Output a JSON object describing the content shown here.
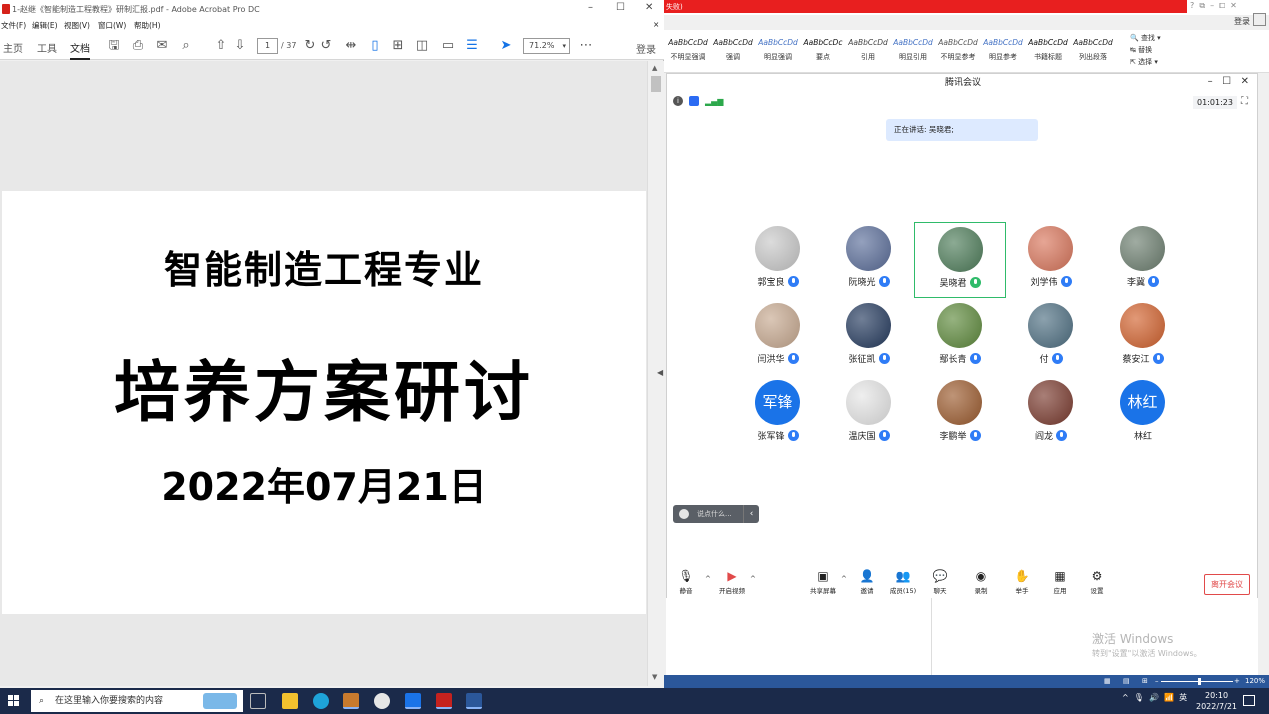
{
  "acrobat": {
    "title": "1-赵继《智能制造工程教程》研制汇报.pdf - Adobe Acrobat Pro DC",
    "menu": [
      "文件(F)",
      "编辑(E)",
      "视图(V)",
      "窗口(W)",
      "帮助(H)"
    ],
    "nav": [
      "主页",
      "工具",
      "文档"
    ],
    "page_current": "1",
    "page_total": "/ 37",
    "zoom": "71.2%",
    "login": "登录",
    "doc": {
      "line1": "智能制造工程专业",
      "line2": "培养方案研讨",
      "line3": "2022年07月21日"
    }
  },
  "word": {
    "banner": "失败)",
    "login": "登录",
    "styles": [
      {
        "sample": "AaBbCcDd",
        "name": "不明显强调",
        "color": "#222222"
      },
      {
        "sample": "AaBbCcDd",
        "name": "强调",
        "color": "#222222"
      },
      {
        "sample": "AaBbCcDd",
        "name": "明显强调",
        "color": "#4472c4"
      },
      {
        "sample": "AaBbCcDc",
        "name": "要点",
        "color": "#111111"
      },
      {
        "sample": "AaBbCcDd",
        "name": "引用",
        "color": "#444444"
      },
      {
        "sample": "AaBbCcDd",
        "name": "明显引用",
        "color": "#4472c4"
      },
      {
        "sample": "AaBbCcDd",
        "name": "不明显参考",
        "color": "#555555"
      },
      {
        "sample": "AaBbCcDd",
        "name": "明显参考",
        "color": "#4472c4"
      },
      {
        "sample": "AaBbCcDd",
        "name": "书籍标题",
        "color": "#111111"
      },
      {
        "sample": "AaBbCcDd",
        "name": "列出段落",
        "color": "#222222"
      }
    ],
    "editing": [
      "查找 ▾",
      "替换",
      "选择 ▾"
    ],
    "zoom": "120%"
  },
  "meeting": {
    "title": "腾讯会议",
    "timer": "01:01:23",
    "speaking": "正在讲话: 吴晓君;",
    "participants": [
      {
        "name": "郭宝良",
        "mic": "blue",
        "avatar": "#c9c9c9"
      },
      {
        "name": "阮晓光",
        "mic": "blue",
        "avatar": "#5b6e9a"
      },
      {
        "name": "吴晓君",
        "mic": "green",
        "avatar": "#4e7d5a",
        "active": true
      },
      {
        "name": "刘学伟",
        "mic": "blue",
        "avatar": "#d9765c"
      },
      {
        "name": "李冀",
        "mic": "blue",
        "avatar": "#6d7f70"
      },
      {
        "name": "闫洪华",
        "mic": "blue",
        "avatar": "#c7a990"
      },
      {
        "name": "张征凯",
        "mic": "blue",
        "avatar": "#243a5e"
      },
      {
        "name": "鄢长青",
        "mic": "blue",
        "avatar": "#5e8a3c"
      },
      {
        "name": "付",
        "mic": "blue",
        "avatar": "#4e6f82"
      },
      {
        "name": "蔡安江",
        "mic": "blue",
        "avatar": "#d2622e"
      },
      {
        "name": "张军锋",
        "mic": "blue",
        "avatar": "#1a73e8",
        "initials": "军锋"
      },
      {
        "name": "温庆国",
        "mic": "blue",
        "avatar": "#e6e6e6"
      },
      {
        "name": "李鹏举",
        "mic": "blue",
        "avatar": "#9c5b2e"
      },
      {
        "name": "阎龙",
        "mic": "blue",
        "avatar": "#7a3a2e"
      },
      {
        "name": "林红",
        "mic": "none",
        "avatar": "#1a73e8",
        "initials": "林红"
      }
    ],
    "chat_placeholder": "说点什么...",
    "toolbar": {
      "mute": "静音",
      "video": "开启视频",
      "share": "共享屏幕",
      "invite": "邀请",
      "members": "成员(15)",
      "chat": "聊天",
      "record": "录制",
      "hand": "举手",
      "apps": "应用",
      "settings": "设置"
    },
    "leave": "离开会议"
  },
  "watermark": {
    "line1": "激活 Windows",
    "line2": "转到\"设置\"以激活 Windows。"
  },
  "taskbar": {
    "search_placeholder": "在这里输入你要搜索的内容",
    "ime": "英",
    "time": "20:10",
    "date": "2022/7/21"
  }
}
